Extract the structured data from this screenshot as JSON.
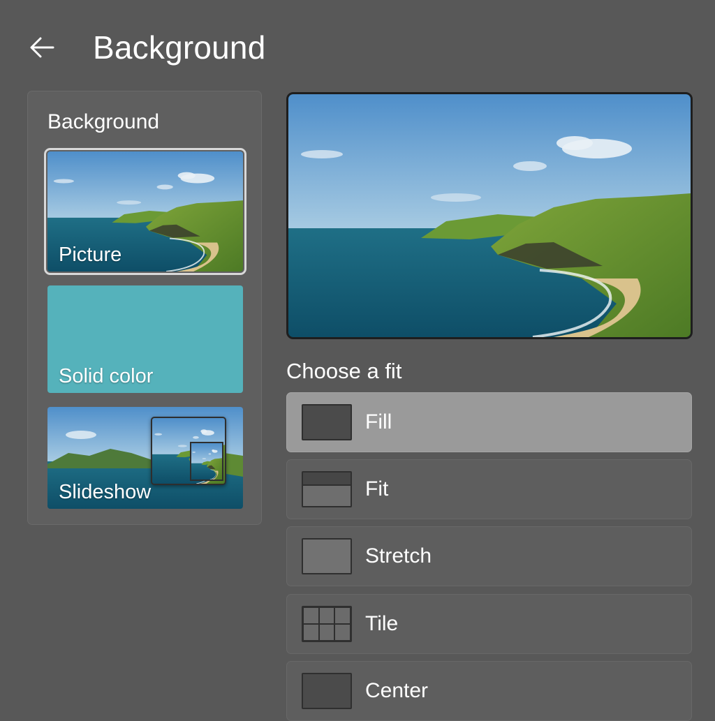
{
  "header": {
    "title": "Background",
    "back_icon": "back-arrow-icon"
  },
  "background_panel": {
    "title": "Background",
    "options": [
      {
        "label": "Picture",
        "selected": true
      },
      {
        "label": "Solid color",
        "color": "#55b2bb"
      },
      {
        "label": "Slideshow"
      }
    ]
  },
  "fit": {
    "title": "Choose a fit",
    "options": [
      {
        "label": "Fill",
        "selected": true
      },
      {
        "label": "Fit"
      },
      {
        "label": "Stretch"
      },
      {
        "label": "Tile"
      },
      {
        "label": "Center"
      }
    ]
  },
  "colors": {
    "window_bg": "#585858",
    "selected_fit_bg": "#9a9a9a",
    "solid_color": "#55b2bb"
  }
}
